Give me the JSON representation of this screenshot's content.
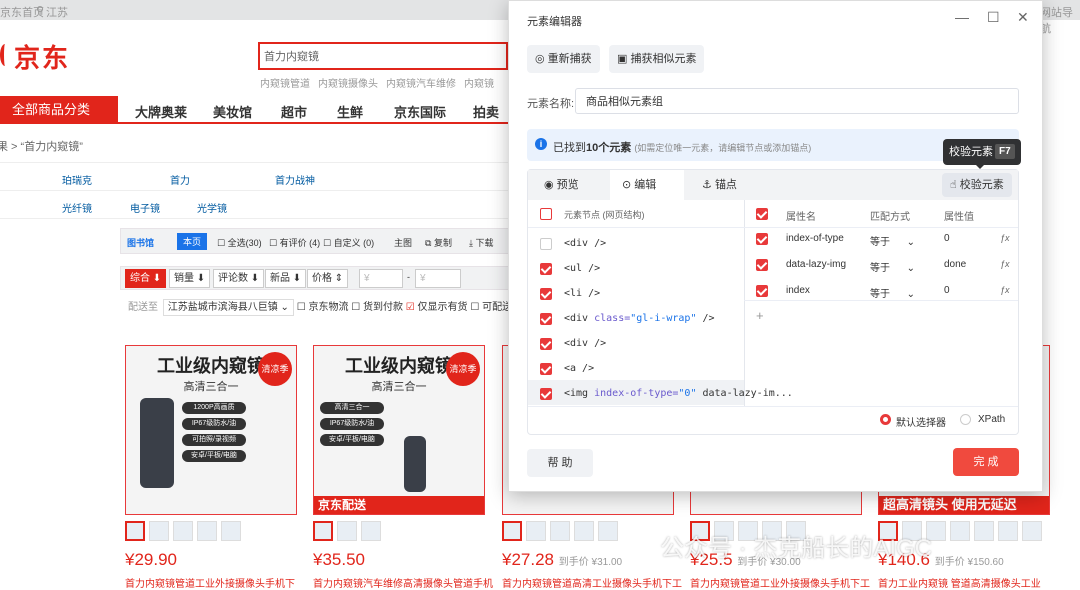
{
  "topbar": {
    "home": "京东首页",
    "location": "江苏",
    "right": "网站导航"
  },
  "logo": {
    "text": "京东"
  },
  "search": {
    "value": "首力内窥镜"
  },
  "hotwords": [
    "内窥镜管道",
    "内窥镜摄像头",
    "内窥镜汽车维修",
    "内窥镜"
  ],
  "nav": {
    "all": "全部商品分类",
    "items": [
      "大牌奥莱",
      "美妆馆",
      "超市",
      "生鲜",
      "京东国际",
      "拍卖"
    ]
  },
  "crumb": "全部结果 > “首力内窥镜”",
  "brands": [
    "珀瑞克",
    "首力",
    "首力战神",
    "光纤镜",
    "电子镜",
    "光学镜"
  ],
  "filter": {
    "logo": "图书馆",
    "this_page": "本页",
    "all": "全选(30)",
    "has_comment": "有评价 (4)",
    "custom": "自定义 (0)",
    "main": "主图",
    "copy": "复制",
    "download": "下载"
  },
  "sort": {
    "composite": "综合",
    "sales": "销量",
    "comments": "评论数",
    "new": "新品",
    "price": "价格",
    "min_ph": "¥",
    "max_ph": "¥"
  },
  "delivery": {
    "label": "配送至",
    "address": "江苏盐城市滨海县八巨镇",
    "jd": "京东物流",
    "cod": "货到付款",
    "in_stock": "仅显示有货",
    "other": "可配送"
  },
  "products": [
    {
      "title": "工业级内窥镜",
      "sub": "高清三合一",
      "tags": [
        "1200P高画质",
        "IP67级防水/油",
        "可拍照/录视频",
        "安卓/平板/电脑"
      ],
      "badge": "清凉季",
      "bottom": "",
      "price": "¥29.90",
      "extra": "",
      "text": "首力内窥镜管道工业外接摄像头手机下"
    },
    {
      "title": "工业级内窥镜",
      "sub": "高清三合一",
      "tags": [
        "高清三合一",
        "IP67级防水/油",
        "安卓/平板/电脑"
      ],
      "badge": "清凉季",
      "bottom": "京东配送",
      "price": "¥35.50",
      "extra": "",
      "text": "首力内窥镜汽车维修高清摄像头管道手机"
    },
    {
      "title": "",
      "sub": "",
      "tags": [],
      "badge": "",
      "bottom": "",
      "price": "¥27.28",
      "extra": "到手价 ¥31.00",
      "text": "首力内窥镜管道高清工业摄像头手机下工"
    },
    {
      "title": "",
      "sub": "",
      "tags": [],
      "badge": "",
      "bottom": "",
      "price": "¥25.5",
      "extra": "到手价 ¥30.00",
      "text": "首力内窥镜管道工业外接摄像头手机下工"
    },
    {
      "title": "",
      "sub": "",
      "tags": [],
      "badge": "",
      "bottom": "超高清镜头 使用无延迟",
      "price": "¥140.6",
      "extra": "到手价 ¥150.60",
      "text": "首力工业内窥镜 管道高清摄像头工业"
    }
  ],
  "dialog": {
    "title": "元素编辑器",
    "recapture": "重新捕获",
    "capture_similar": "捕获相似元素",
    "name_label": "元素名称:",
    "name_value": "商品相似元素组",
    "info_prefix": "已找到",
    "info_count": "10个元素",
    "info_hint": "(如需定位唯一元素，请编辑节点或添加锚点)",
    "tooltip": "校验元素",
    "tooltip_key": "F7",
    "tabs": [
      "预览",
      "编辑",
      "锚点"
    ],
    "validate": "校验元素",
    "nodes_header": "元素节点 (网页结构)",
    "nodes": [
      {
        "tag": "<div />",
        "checked": false
      },
      {
        "tag": "<ul />",
        "checked": true
      },
      {
        "tag": "<li />",
        "checked": true
      },
      {
        "tag": "<div ",
        "attr": "class=",
        "val": "\"gl-i-wrap\"",
        "end": " />",
        "checked": true
      },
      {
        "tag": "<div />",
        "checked": true
      },
      {
        "tag": "<a />",
        "checked": true
      },
      {
        "tag": "<img ",
        "attr": "index-of-type=",
        "val": "\"0\"",
        "end": " data-lazy-im...",
        "checked": true
      }
    ],
    "attr_headers": [
      "属性名",
      "匹配方式",
      "属性值"
    ],
    "attrs": [
      {
        "name": "index-of-type",
        "match": "等于",
        "value": "0"
      },
      {
        "name": "data-lazy-img",
        "match": "等于",
        "value": "done"
      },
      {
        "name": "index",
        "match": "等于",
        "value": "0"
      }
    ],
    "add": "+",
    "fx": "ƒx",
    "selector_default": "默认选择器",
    "selector_xpath": "XPath",
    "help": "帮 助",
    "done": "完 成"
  },
  "watermark": "公众号 · 杰克船长的AIGC"
}
